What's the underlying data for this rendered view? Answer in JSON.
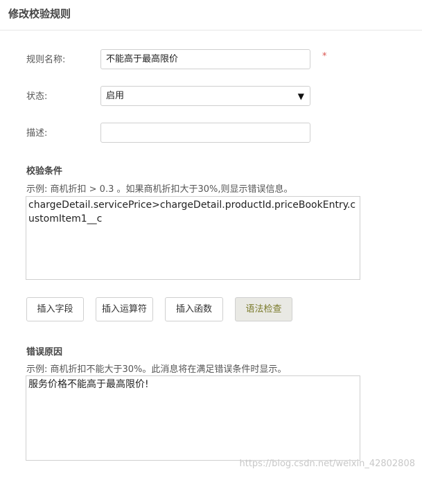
{
  "header": {
    "title": "修改校验规则"
  },
  "form": {
    "name_label": "规则名称:",
    "name_value": "不能高于最高限价",
    "required_mark": "*",
    "status_label": "状态:",
    "status_value": "启用",
    "status_arrow": "▼",
    "desc_label": "描述:",
    "desc_value": ""
  },
  "condition": {
    "title": "校验条件",
    "example": "示例: 商机折扣 > 0.3 。如果商机折扣大于30%,则显示错误信息。",
    "value": "chargeDetail.servicePrice>chargeDetail.productId.priceBookEntry.customItem1__c"
  },
  "buttons": {
    "insert_field": "插入字段",
    "insert_operator": "插入运算符",
    "insert_function": "插入函数",
    "syntax_check": "语法检查"
  },
  "error": {
    "title": "错误原因",
    "example": "示例: 商机折扣不能大于30%。此消息将在满足错误条件时显示。",
    "value": "服务价格不能高于最高限价!"
  },
  "watermark": "https://blog.csdn.net/weixin_42802808"
}
